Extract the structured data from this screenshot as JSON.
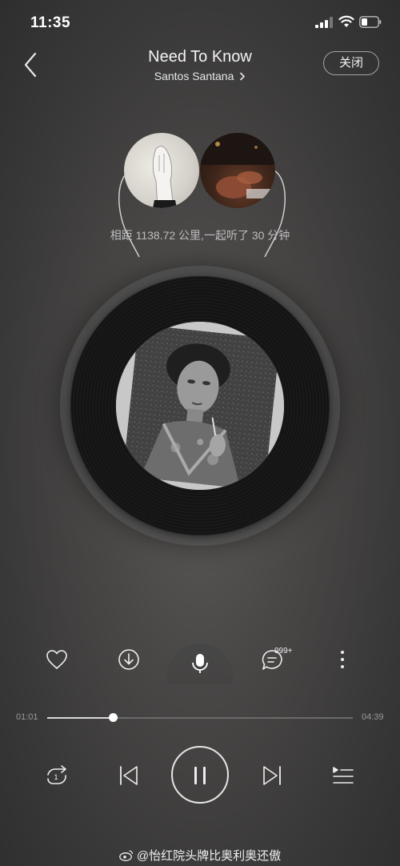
{
  "status_bar": {
    "time": "11:35"
  },
  "header": {
    "title": "Need To Know",
    "artist": "Santos Santana",
    "close_label": "关闭"
  },
  "listen_together": {
    "distance_text": "相距 1138.72 公里,一起听了 30 分钟"
  },
  "actions": {
    "comment_count": "999+"
  },
  "progress": {
    "elapsed": "01:01",
    "total": "04:39",
    "fraction": 0.217
  },
  "watermark": "@怡红院头牌比奥利奥还傲",
  "colors": {
    "background": "#3f3e3e",
    "accent": "#ffffff"
  },
  "icons": [
    "back-chevron-icon",
    "heart-icon",
    "download-icon",
    "mic-icon",
    "comment-icon",
    "more-icon",
    "repeat-one-icon",
    "previous-icon",
    "pause-icon",
    "next-icon",
    "playlist-icon",
    "weibo-icon"
  ]
}
